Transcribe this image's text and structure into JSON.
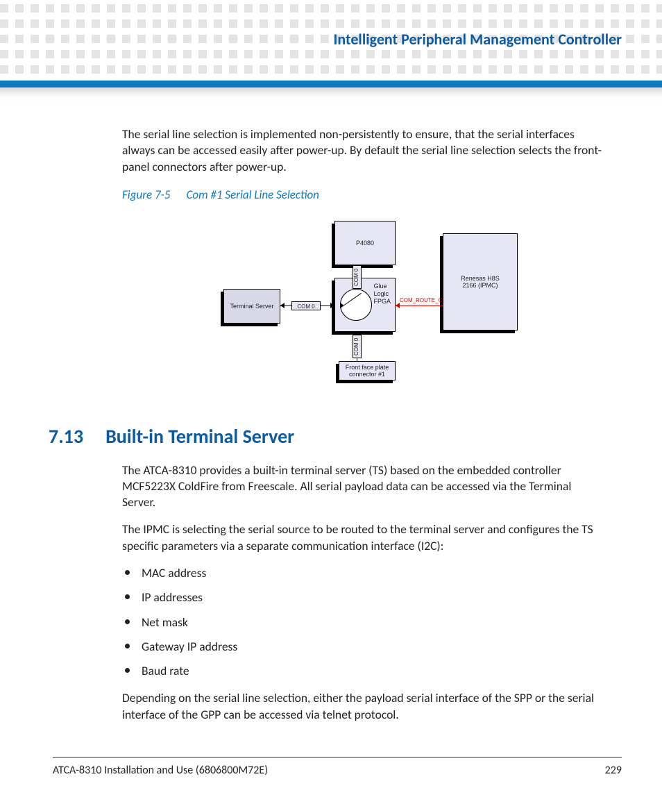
{
  "header": {
    "title": "Intelligent Peripheral Management Controller"
  },
  "intro_para": "The serial line selection is implemented non-persistently to ensure, that the serial interfaces always can be accessed easily after power-up. By default the serial line selection selects the front-panel connectors after power-up.",
  "figure": {
    "caption_prefix": "Figure 7-5",
    "caption_title": "Com #1 Serial Line Selection",
    "blocks": {
      "p4080": "P4080",
      "terminal_server": "Terminal Server",
      "glue_logic_l1": "Glue",
      "glue_logic_l2": "Logic",
      "glue_logic_l3": "FPGA",
      "renesas_l1": "Renesas H8S",
      "renesas_l2": "2166 (IPMC)",
      "front_l1": "Front face plate",
      "front_l2": "connector #1",
      "com0": "COM 0",
      "com0_top": "COM 0",
      "com0_bot": "COM 0",
      "com_route_c": "COM_ROUTE_C"
    }
  },
  "section": {
    "number": "7.13",
    "title": "Built-in Terminal Server",
    "p1": "The ATCA-8310 provides a built-in terminal server (TS) based on the embedded controller MCF5223X ColdFire from Freescale. All serial payload data can be accessed via the Terminal Server.",
    "p2": "The IPMC is selecting the serial source to be routed to the terminal server and configures the TS specific parameters via a separate communication interface (I2C):",
    "bullets": [
      "MAC address",
      "IP addresses",
      "Net mask",
      "Gateway IP address",
      "Baud rate"
    ],
    "p3": "Depending on the serial line selection, either the payload serial interface of the SPP or the serial interface of the GPP can be accessed via telnet protocol."
  },
  "footer": {
    "doc": "ATCA-8310 Installation and Use (6806800M72E)",
    "page": "229"
  }
}
